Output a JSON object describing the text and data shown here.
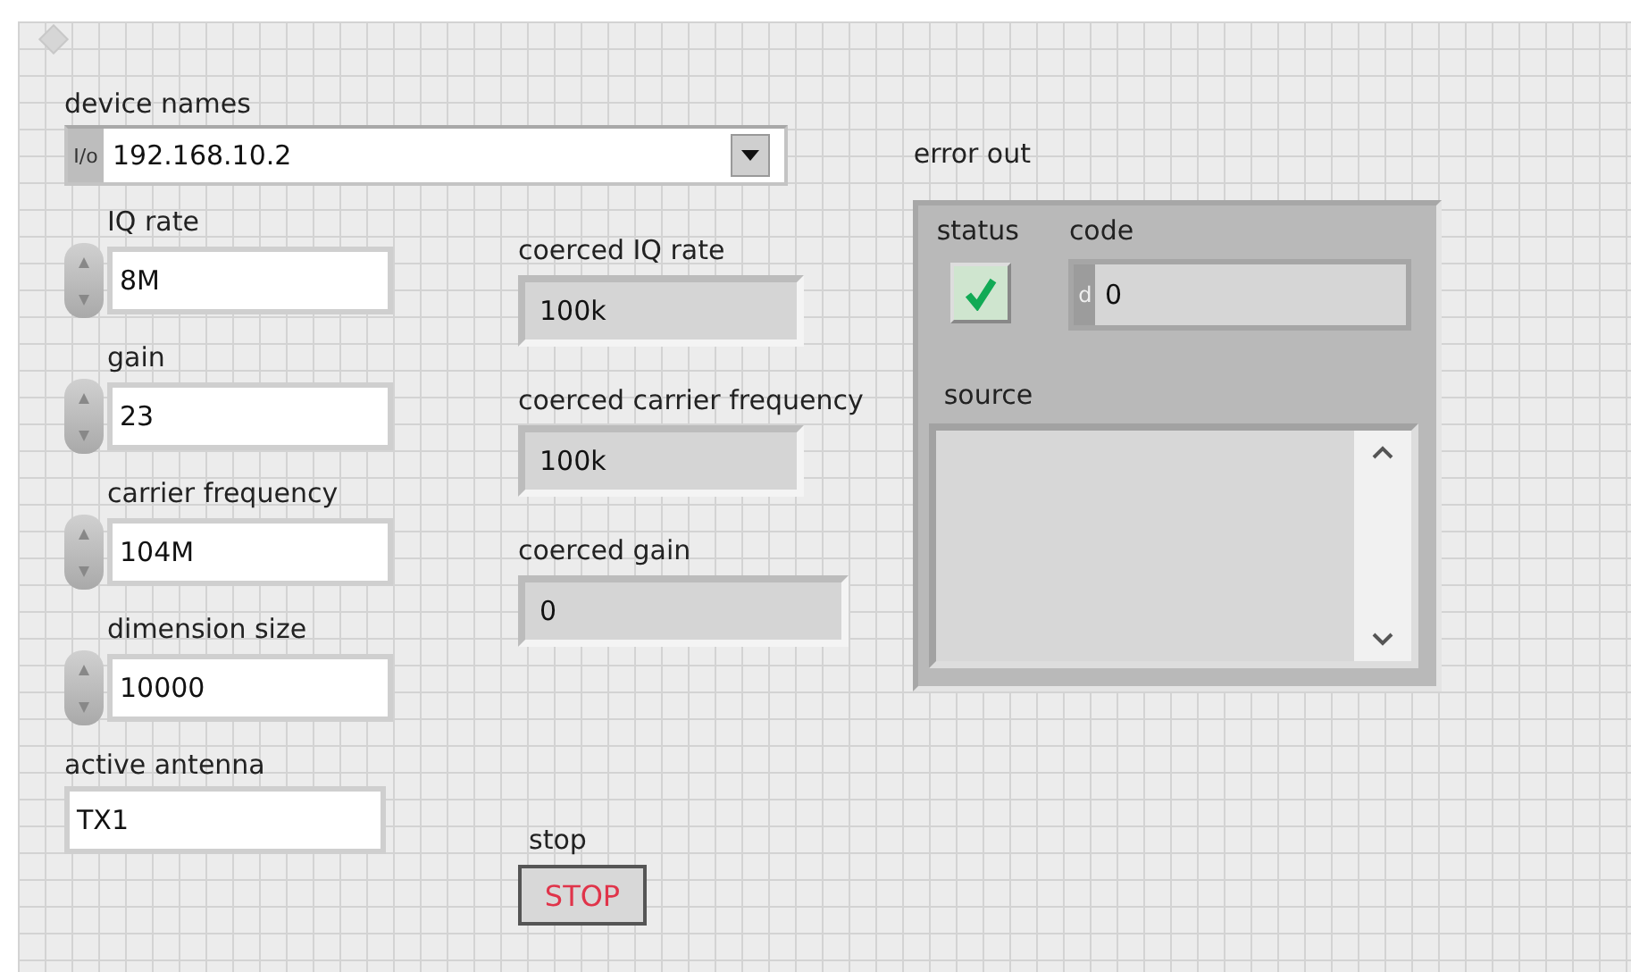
{
  "device_names": {
    "label": "device names",
    "prefix": "I/o",
    "value": "192.168.10.2"
  },
  "controls": [
    {
      "label": "IQ rate",
      "value": "8M"
    },
    {
      "label": "gain",
      "value": "23"
    },
    {
      "label": "carrier frequency",
      "value": "104M"
    },
    {
      "label": "dimension size",
      "value": "10000"
    }
  ],
  "active_antenna": {
    "label": "active antenna",
    "value": "TX1"
  },
  "indicators": [
    {
      "label": "coerced IQ rate",
      "value": "100k"
    },
    {
      "label": "coerced carrier frequency",
      "value": "100k"
    },
    {
      "label": "coerced gain",
      "value": "0"
    }
  ],
  "stop": {
    "label": "stop",
    "text": "STOP",
    "pressed": false
  },
  "error_out": {
    "label": "error out",
    "status_label": "status",
    "status": false,
    "code_label": "code",
    "code_prefix": "d",
    "code": "0",
    "source_label": "source"
  }
}
